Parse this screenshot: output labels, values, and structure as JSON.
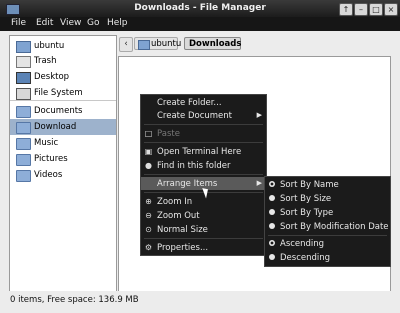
{
  "window": {
    "title": "Downloads - File Manager",
    "controls": [
      "↑",
      "–",
      "□",
      "×"
    ]
  },
  "menubar": [
    "File",
    "Edit",
    "View",
    "Go",
    "Help"
  ],
  "sidebar": {
    "items": [
      {
        "label": "ubuntu",
        "icon": "home-icon",
        "selected": false
      },
      {
        "label": "Trash",
        "icon": "trash-icon",
        "selected": false
      },
      {
        "label": "Desktop",
        "icon": "desktop-icon",
        "selected": false
      },
      {
        "label": "File System",
        "icon": "drive-icon",
        "selected": false
      },
      {
        "label": "Documents",
        "icon": "folder-icon",
        "selected": false
      },
      {
        "label": "Download",
        "icon": "folder-icon",
        "selected": true
      },
      {
        "label": "Music",
        "icon": "folder-icon",
        "selected": false
      },
      {
        "label": "Pictures",
        "icon": "folder-icon",
        "selected": false
      },
      {
        "label": "Videos",
        "icon": "folder-icon",
        "selected": false
      }
    ]
  },
  "location": {
    "back": "‹",
    "crumbs": [
      "ubuntu",
      "Downloads"
    ]
  },
  "context_menu": {
    "items": [
      {
        "label": "Create Folder...",
        "disabled": false,
        "submenu": false,
        "icon": ""
      },
      {
        "label": "Create Document",
        "disabled": false,
        "submenu": true,
        "icon": ""
      },
      {
        "label": "Paste",
        "disabled": true,
        "submenu": false,
        "icon": "paste-icon"
      },
      {
        "label": "Open Terminal Here",
        "disabled": false,
        "submenu": false,
        "icon": "terminal-icon"
      },
      {
        "label": "Find in this folder",
        "disabled": false,
        "submenu": false,
        "icon": "find-icon"
      },
      {
        "label": "Arrange Items",
        "disabled": false,
        "submenu": true,
        "icon": "",
        "highlighted": true
      },
      {
        "label": "Zoom In",
        "disabled": false,
        "submenu": false,
        "icon": "zoom-in-icon"
      },
      {
        "label": "Zoom Out",
        "disabled": false,
        "submenu": false,
        "icon": "zoom-out-icon"
      },
      {
        "label": "Normal Size",
        "disabled": false,
        "submenu": false,
        "icon": "zoom-normal-icon"
      },
      {
        "label": "Properties...",
        "disabled": false,
        "submenu": false,
        "icon": "properties-icon"
      }
    ],
    "arrow": "▶"
  },
  "arrange_submenu": {
    "items": [
      {
        "label": "Sort By Name",
        "checked": true
      },
      {
        "label": "Sort By Size",
        "checked": false
      },
      {
        "label": "Sort By Type",
        "checked": false
      },
      {
        "label": "Sort By Modification Date",
        "checked": false
      },
      {
        "label": "Ascending",
        "checked": true
      },
      {
        "label": "Descending",
        "checked": false
      }
    ]
  },
  "status": {
    "text": "0 items, Free space: 136.9 MB"
  }
}
